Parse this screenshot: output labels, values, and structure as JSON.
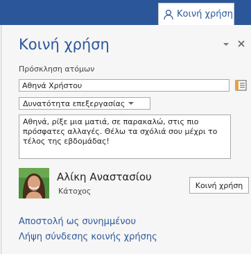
{
  "ribbon": {
    "share_tab": {
      "label": "Κοινή χρήση",
      "icon": "person-icon"
    }
  },
  "pane": {
    "title": "Κοινή χρήση",
    "dropdown_icon": "chevron-down-icon",
    "close_icon": "close-icon",
    "invite": {
      "label": "Πρόσκληση ατόμων",
      "value": "Αθηνά Χρήστου",
      "address_book_icon": "address-book-icon"
    },
    "permission": {
      "selected": "Δυνατότητα επεξεργασίας",
      "icon": "chevron-down-icon"
    },
    "message": "Αθηνά, ρίξε μια ματιά, σε παρακαλώ, στις πιο πρόσφατες αλλαγές. Θέλω τα σχόλιά σου μέχρι το τέλος της εβδομάδας!",
    "share_button": "Κοινή χρήση",
    "owner": {
      "name": "Αλίκη Αναστασίου",
      "role": "Κάτοχος"
    },
    "links": {
      "send_attachment": "Αποστολή ως συνημμένου",
      "get_link": "Λήψη σύνδεσης κοινής χρήσης"
    }
  },
  "colors": {
    "accent": "#2b579a",
    "pane_background": "#f6f6f6"
  }
}
